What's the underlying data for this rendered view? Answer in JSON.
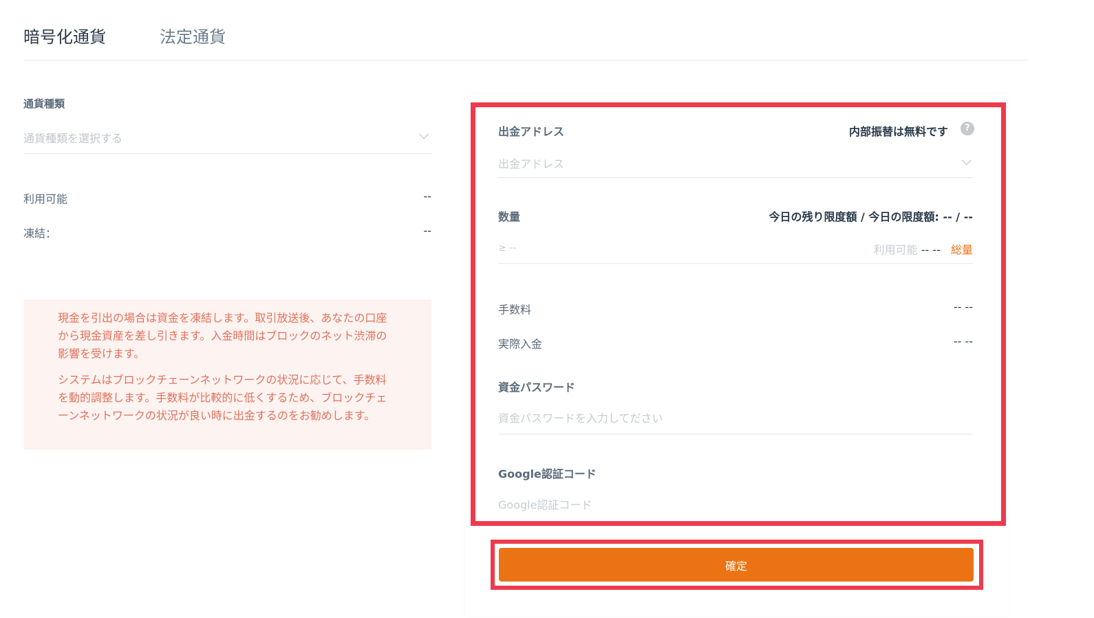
{
  "tabs": [
    {
      "label": "暗号化通貨",
      "active": true
    },
    {
      "label": "法定通貨",
      "active": false
    }
  ],
  "left": {
    "currency_label": "通貨種類",
    "currency_placeholder": "通貨種類を選択する",
    "available_label": "利用可能",
    "available_value": "--",
    "frozen_label": "凍結：",
    "frozen_value": "--",
    "notice": [
      "現金を引出の場合は資金を凍結します。取引放送後、あなたの口座から現金資産を差し引きます。入金時間はブロックのネット渋滞の影響を受けます。",
      "システムはブロックチェーンネットワークの状況に応じて、手数料を動的調整します。手数料が比較的に低くするため、ブロックチェーンネットワークの状況が良い時に出金するのをお勧めします。"
    ]
  },
  "right": {
    "address_label": "出金アドレス",
    "internal_free": "内部振替は無料です",
    "help_icon": "?",
    "address_placeholder": "出金アドレス",
    "amount_label": "数量",
    "limit_text": "今日の残り限度額 / 今日の限度額: -- / --",
    "amount_placeholder": "≥ --",
    "available_label": "利用可能",
    "available_value": "-- --",
    "total_link": "総量",
    "fee_label": "手数料",
    "fee_value": "-- --",
    "actual_label": "実際入金",
    "actual_value": "-- --",
    "fund_pw_label": "資金パスワード",
    "fund_pw_placeholder": "資金パスワードを入力してださい",
    "google_label": "Google認証コード",
    "google_placeholder": "Google認証コード",
    "confirm_label": "確定"
  },
  "colors": {
    "accent": "#ec7314",
    "highlight": "#ef3a4d",
    "notice_text": "#e2725b",
    "notice_bg": "#fdf3f1"
  }
}
